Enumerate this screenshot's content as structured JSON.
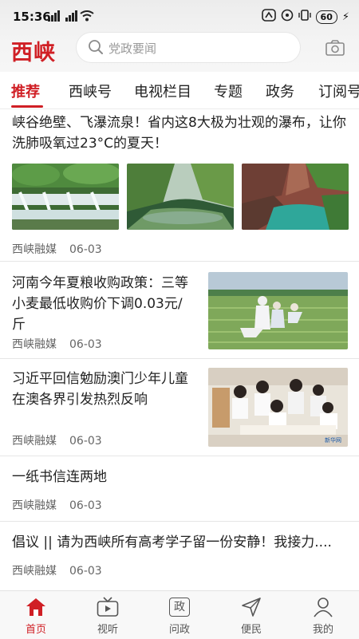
{
  "status": {
    "time": "15:36",
    "battery": "60"
  },
  "header": {
    "logo": "西峡",
    "search_placeholder": "党政要闻"
  },
  "tabs": [
    {
      "label": "推荐",
      "active": true
    },
    {
      "label": "西峡号"
    },
    {
      "label": "电视栏目"
    },
    {
      "label": "专题"
    },
    {
      "label": "政务"
    },
    {
      "label": "订阅号"
    }
  ],
  "feed": [
    {
      "title": "峡谷绝壁、飞瀑流泉！省内这8大极为壮观的瀑布，让你洗肺吸氧过23°C的夏天！",
      "source": "西峡融媒",
      "date": "06-03",
      "images": [
        "waterfall-cascade-photo",
        "river-valley-photo",
        "canyon-gorge-photo"
      ]
    },
    {
      "title": "河南今年夏粮收购政策：三等小麦最低收购价下调0.03元/斤",
      "source": "西峡融媒",
      "date": "06-03",
      "image": "wheat-field-photo"
    },
    {
      "title": "习近平回信勉励澳门少年儿童在澳各界引发热烈反响",
      "source": "西峡融媒",
      "date": "06-03",
      "image": "children-classroom-photo",
      "image_watermark": "新华网"
    },
    {
      "title": "一纸书信连两地",
      "source": "西峡融媒",
      "date": "06-03"
    },
    {
      "title": "倡议 || 请为西峡所有高考学子留一份安静！我接力....",
      "source": "西峡融媒",
      "date": "06-03"
    }
  ],
  "bottom_nav": [
    {
      "label": "首页",
      "icon": "home-icon",
      "active": true
    },
    {
      "label": "视听",
      "icon": "tv-icon"
    },
    {
      "label": "问政",
      "icon": "zheng-icon",
      "glyph": "政"
    },
    {
      "label": "便民",
      "icon": "send-icon"
    },
    {
      "label": "我的",
      "icon": "user-icon"
    }
  ],
  "colors": {
    "accent": "#d01f25",
    "text": "#222222",
    "meta": "#666666"
  }
}
